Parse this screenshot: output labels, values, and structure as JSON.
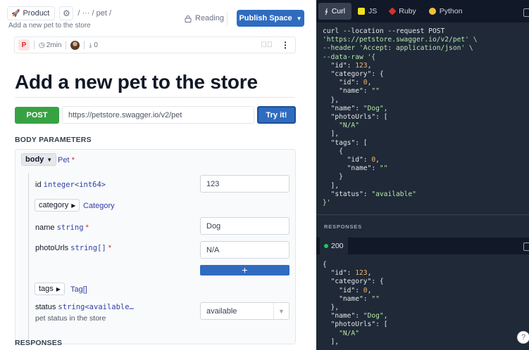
{
  "header": {
    "product_label": "Product",
    "breadcrumb": "/  ···  /  pet  /",
    "subtitle": "Add a new pet to the store",
    "reading_label": "Reading",
    "publish_label": "Publish Space"
  },
  "meta": {
    "badge": "P",
    "read_time": "2min",
    "merge_count": "0"
  },
  "page": {
    "title": "Add a new pet to the store",
    "method": "POST",
    "url": "https://petstore.swagger.io/v2/pet",
    "try_label": "Try it!",
    "body_params_label": "BODY PARAMETERS",
    "responses_label": "RESPONSES"
  },
  "body": {
    "pill": "body",
    "schema": "Pet",
    "required_mark": "*",
    "fields": {
      "id": {
        "name": "id",
        "type": "integer<int64>",
        "value": "123"
      },
      "category": {
        "pill": "category",
        "type": "Category"
      },
      "name": {
        "name": "name",
        "type": "string",
        "value": "Dog"
      },
      "photoUrls": {
        "name": "photoUrls",
        "type": "string[]",
        "value": "N/A",
        "add": "+"
      },
      "tags": {
        "pill": "tags",
        "type": "Tag[]"
      },
      "status": {
        "name": "status",
        "type": "string<available…",
        "desc": "pet status in the store",
        "value": "available"
      }
    }
  },
  "code_panel": {
    "tabs": [
      {
        "label": "Curl",
        "active": true
      },
      {
        "label": "JS",
        "active": false
      },
      {
        "label": "Ruby",
        "active": false
      },
      {
        "label": "Python",
        "active": false
      }
    ],
    "curl_lines": [
      "curl --location --request POST",
      "'https://petstore.swagger.io/v2/pet' \\",
      "--header 'Accept: application/json' \\",
      "--data-raw '{",
      "  \"id\": 123,",
      "  \"category\": {",
      "    \"id\": 0,",
      "    \"name\": \"\"",
      "  },",
      "  \"name\": \"Dog\",",
      "  \"photoUrls\": [",
      "    \"N/A\"",
      "  ],",
      "  \"tags\": [",
      "    {",
      "      \"id\": 0,",
      "      \"name\": \"\"",
      "    }",
      "  ],",
      "  \"status\": \"available\"",
      "}'"
    ],
    "responses_label": "RESPONSES",
    "status_code": "200",
    "response_lines": [
      "{",
      "  \"id\": 123,",
      "  \"category\": {",
      "    \"id\": 0,",
      "    \"name\": \"\"",
      "  },",
      "  \"name\": \"Dog\",",
      "  \"photoUrls\": [",
      "    \"N/A\"",
      "  ],"
    ]
  },
  "help_label": "?",
  "colors": {
    "accent": "#2f6cc0",
    "post": "#37a244",
    "code_bg": "#1f2937"
  }
}
